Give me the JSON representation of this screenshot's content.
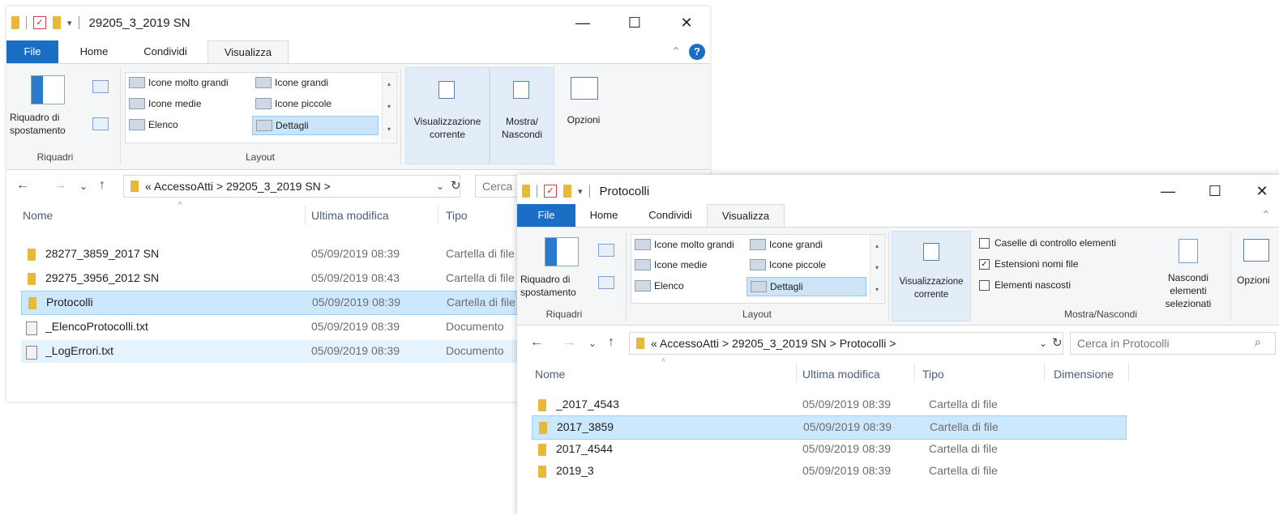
{
  "window1": {
    "title": "29205_3_2019 SN",
    "tabs": {
      "file": "File",
      "home": "Home",
      "share": "Condividi",
      "view": "Visualizza"
    },
    "ribbon": {
      "nav_pane": "Riquadro di spostamento",
      "panes_group": "Riquadri",
      "layout_items": [
        "Icone molto grandi",
        "Icone grandi",
        "Icone medie",
        "Icone piccole",
        "Elenco",
        "Dettagli"
      ],
      "layout_group": "Layout",
      "current_view": "Visualizzazione corrente",
      "show_hide": "Mostra/ Nascondi",
      "options": "Opzioni"
    },
    "address": {
      "path": "« AccessoAtti  >  29205_3_2019 SN  >",
      "search": "Cerca"
    },
    "columns": {
      "name": "Nome",
      "modified": "Ultima modifica",
      "type": "Tipo"
    },
    "rows": [
      {
        "name": "28277_3859_2017 SN",
        "modified": "05/09/2019 08:39",
        "type": "Cartella di file",
        "icon": "folder-icon"
      },
      {
        "name": "29275_3956_2012 SN",
        "modified": "05/09/2019 08:43",
        "type": "Cartella di file",
        "icon": "folder-icon"
      },
      {
        "name": "Protocolli",
        "modified": "05/09/2019 08:39",
        "type": "Cartella di file",
        "icon": "folder-icon"
      },
      {
        "name": "_ElencoProtocolli.txt",
        "modified": "05/09/2019 08:39",
        "type": "Documento",
        "icon": "text-file-icon"
      },
      {
        "name": "_LogErrori.txt",
        "modified": "05/09/2019 08:39",
        "type": "Documento",
        "icon": "text-file-icon"
      }
    ]
  },
  "window2": {
    "title": "Protocolli",
    "tabs": {
      "file": "File",
      "home": "Home",
      "share": "Condividi",
      "view": "Visualizza"
    },
    "ribbon": {
      "nav_pane": "Riquadro di spostamento",
      "panes_group": "Riquadri",
      "layout_items": [
        "Icone molto grandi",
        "Icone grandi",
        "Icone medie",
        "Icone piccole",
        "Elenco",
        "Dettagli"
      ],
      "layout_group": "Layout",
      "current_view": "Visualizzazione corrente",
      "checkboxes": [
        {
          "label": "Caselle di controllo elementi",
          "checked": false
        },
        {
          "label": "Estensioni nomi file",
          "checked": true
        },
        {
          "label": "Elementi nascosti",
          "checked": false
        }
      ],
      "hide_selected": "Nascondi elementi selezionati",
      "show_hide_group": "Mostra/Nascondi",
      "options": "Opzioni"
    },
    "address": {
      "path": "« AccessoAtti  >  29205_3_2019 SN  >  Protocolli  >",
      "search": "Cerca in Protocolli"
    },
    "columns": {
      "name": "Nome",
      "modified": "Ultima modifica",
      "type": "Tipo",
      "size": "Dimensione"
    },
    "rows": [
      {
        "name": "_2017_4543",
        "modified": "05/09/2019 08:39",
        "type": "Cartella di file"
      },
      {
        "name": "2017_3859",
        "modified": "05/09/2019 08:39",
        "type": "Cartella di file"
      },
      {
        "name": "2017_4544",
        "modified": "05/09/2019 08:39",
        "type": "Cartella di file"
      },
      {
        "name": "2019_3",
        "modified": "05/09/2019 08:39",
        "type": "Cartella di file"
      }
    ]
  },
  "colors": {
    "file_tab": "#1a6fc4",
    "selection": "#cce8ff",
    "folder": "#e7b83a"
  }
}
